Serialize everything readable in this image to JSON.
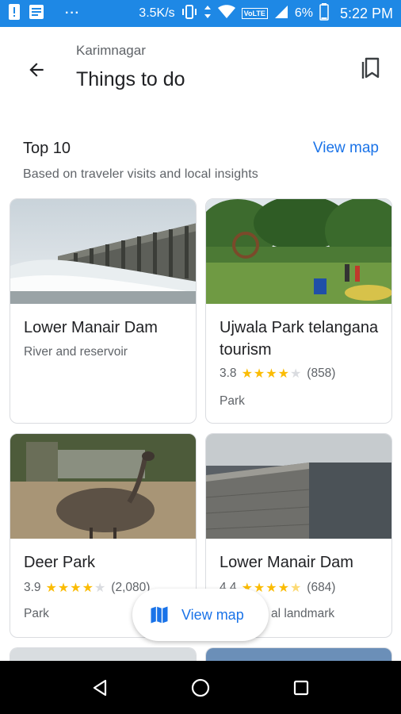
{
  "status_bar": {
    "net_speed": "3.5K/s",
    "volte": "VoLTE",
    "battery": "6%",
    "time": "5:22 PM",
    "dots": "···"
  },
  "header": {
    "breadcrumb": "Karimnagar",
    "title": "Things to do"
  },
  "section": {
    "title": "Top 10",
    "view_map": "View map",
    "subtitle": "Based on traveler visits and local insights"
  },
  "places": [
    {
      "name": "Lower Manair Dam",
      "rating": "",
      "stars": 0,
      "reviews": "",
      "category": "River and reservoir"
    },
    {
      "name": "Ujwala Park telangana tourism",
      "rating": "3.8",
      "stars": 3.8,
      "reviews": "(858)",
      "category": "Park"
    },
    {
      "name": "Deer Park",
      "rating": "3.9",
      "stars": 3.9,
      "reviews": "(2,080)",
      "category": "Park"
    },
    {
      "name": "Lower Manair Dam",
      "rating": "4.4",
      "stars": 4.4,
      "reviews": "(684)",
      "category": "al landmark"
    }
  ],
  "fab": {
    "label": "View map",
    "icon": "map-icon"
  },
  "colors": {
    "status_bar": "#1e88e5",
    "link": "#1a73e8",
    "star": "#fbbc04"
  }
}
